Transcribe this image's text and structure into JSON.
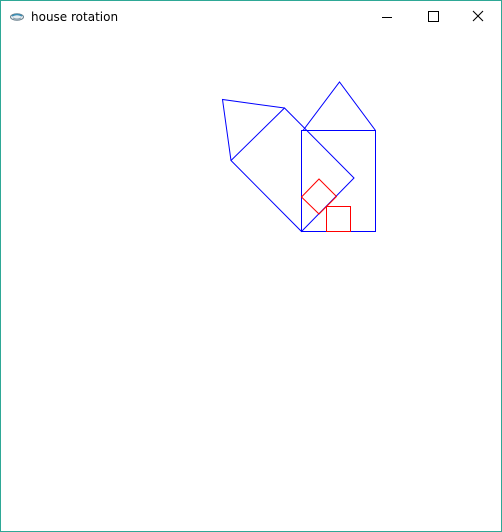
{
  "window": {
    "title": "house rotation",
    "app_icon": "app-icon",
    "border_color": "#2ea896"
  },
  "caption_buttons": {
    "minimize_icon": "minimize-icon",
    "maximize_icon": "maximize-icon",
    "close_icon": "close-icon"
  },
  "drawing": {
    "house_outline_color": "#0000ff",
    "window_outline_color": "#ff0000",
    "original_house": {
      "body": "square",
      "roof": "triangle",
      "window": "square"
    },
    "rotated_house": {
      "rotation_degrees": 45,
      "body": "square",
      "roof": "triangle",
      "window": "square"
    }
  }
}
